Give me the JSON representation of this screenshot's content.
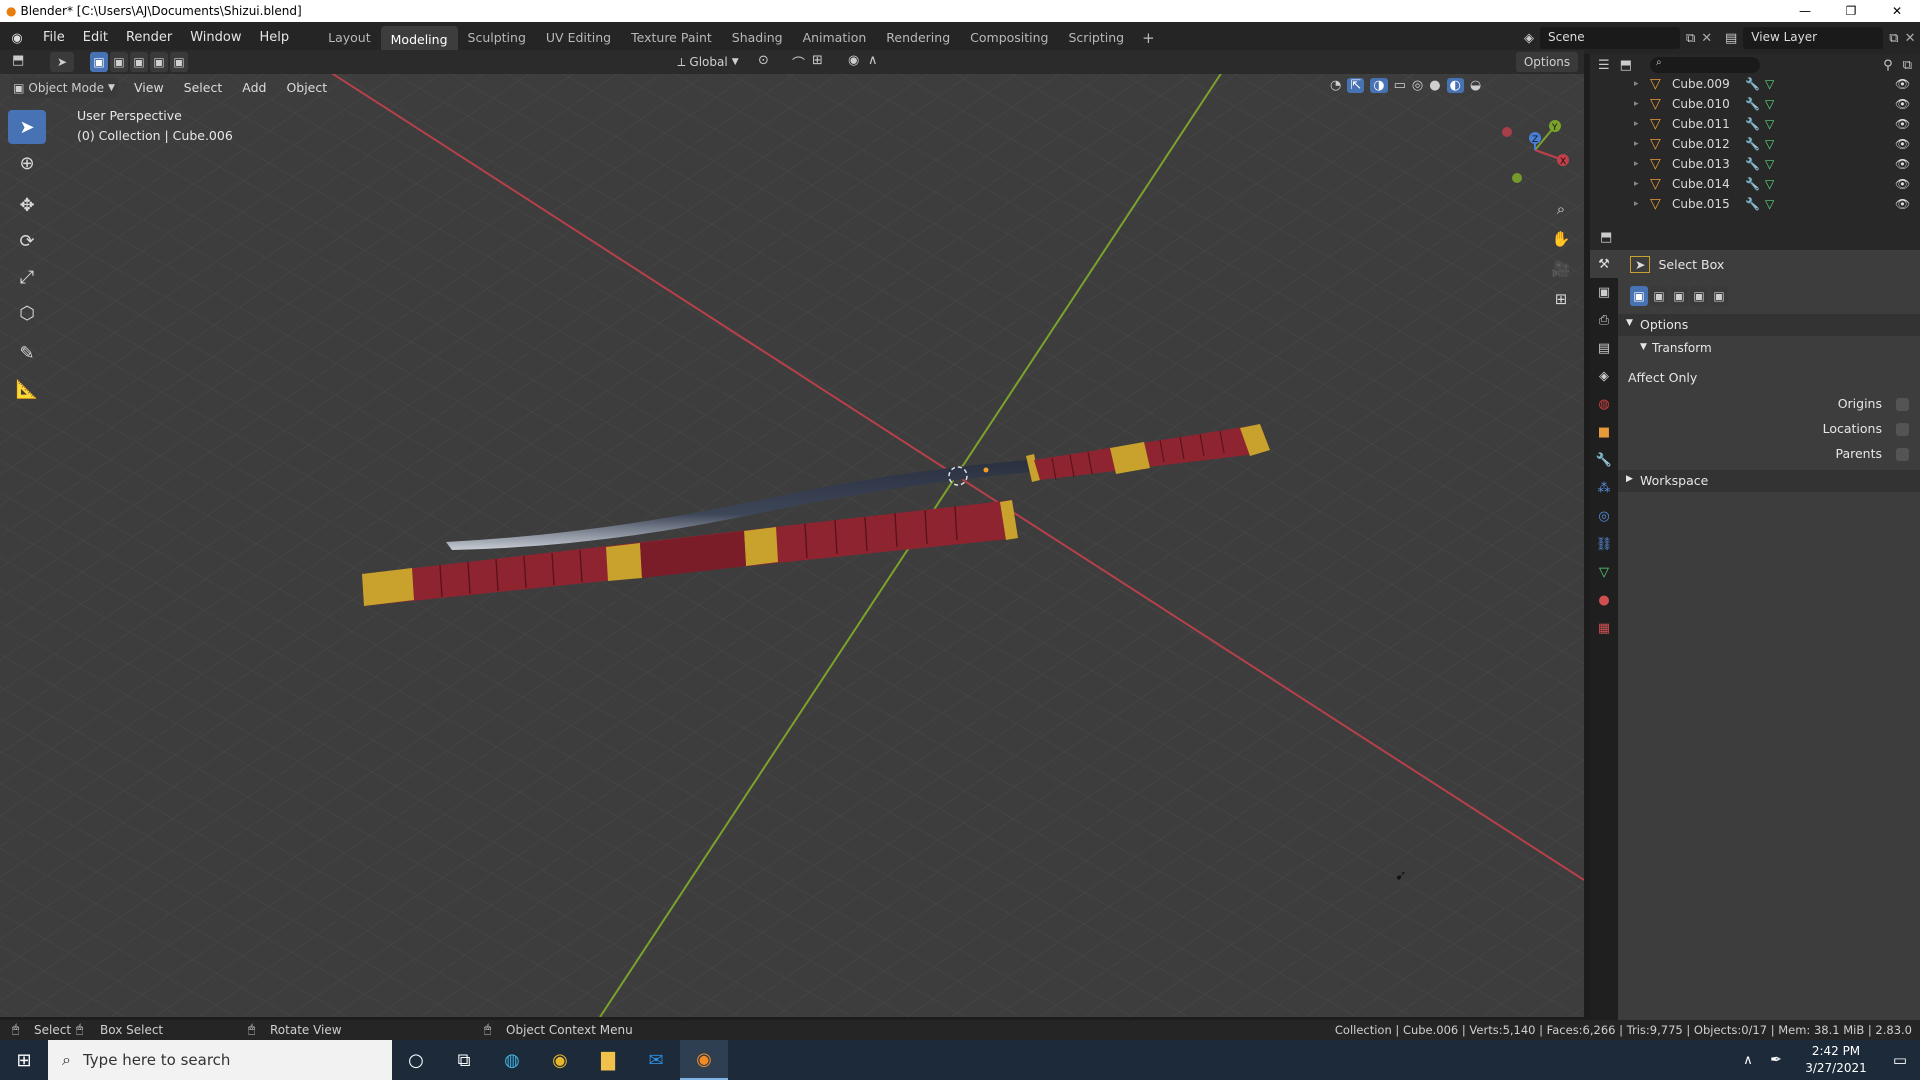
{
  "window": {
    "title": "Blender* [C:\\Users\\AJ\\Documents\\Shizui.blend]",
    "minimize": "—",
    "restore": "❐",
    "close": "✕"
  },
  "menu": [
    "File",
    "Edit",
    "Render",
    "Window",
    "Help"
  ],
  "workspaces": [
    "Layout",
    "Modeling",
    "Sculpting",
    "UV Editing",
    "Texture Paint",
    "Shading",
    "Animation",
    "Rendering",
    "Compositing",
    "Scripting"
  ],
  "active_workspace": "Modeling",
  "add_workspace": "+",
  "scene": {
    "name": "Scene"
  },
  "view_layer": {
    "name": "View Layer"
  },
  "header": {
    "transform_orientation": "Global",
    "options": "Options"
  },
  "viewport_header": {
    "mode": "Object Mode",
    "menus": [
      "View",
      "Select",
      "Add",
      "Object"
    ]
  },
  "viewport": {
    "perspective": "User Perspective",
    "context": "(0) Collection | Cube.006"
  },
  "gizmo": {
    "x": "X",
    "y": "Y",
    "z": "Z"
  },
  "tools": [
    "select-box",
    "cursor",
    "move",
    "rotate",
    "scale",
    "transform",
    "annotate",
    "measure"
  ],
  "outliner": {
    "items": [
      "Cube.009",
      "Cube.010",
      "Cube.011",
      "Cube.012",
      "Cube.013",
      "Cube.014",
      "Cube.015"
    ]
  },
  "properties": {
    "tool_name": "Select Box",
    "options_label": "Options",
    "transform_label": "Transform",
    "affect_only": "Affect Only",
    "origins": "Origins",
    "locations": "Locations",
    "parents": "Parents",
    "workspace_label": "Workspace"
  },
  "statusbar": {
    "select": "Select",
    "box_select": "Box Select",
    "rotate_view": "Rotate View",
    "context_menu": "Object Context Menu",
    "stats": "Collection | Cube.006 | Verts:5,140 | Faces:6,266 | Tris:9,775 | Objects:0/17 | Mem: 38.1 MiB | 2.83.0"
  },
  "taskbar": {
    "search_placeholder": "Type here to search",
    "time": "2:42 PM",
    "date": "3/27/2021"
  },
  "colors": {
    "accent": "#4772b3",
    "x_axis": "#c0404a",
    "y_axis": "#7aa32a",
    "wrap_red": "#8f2431",
    "gold": "#c8a22c"
  }
}
